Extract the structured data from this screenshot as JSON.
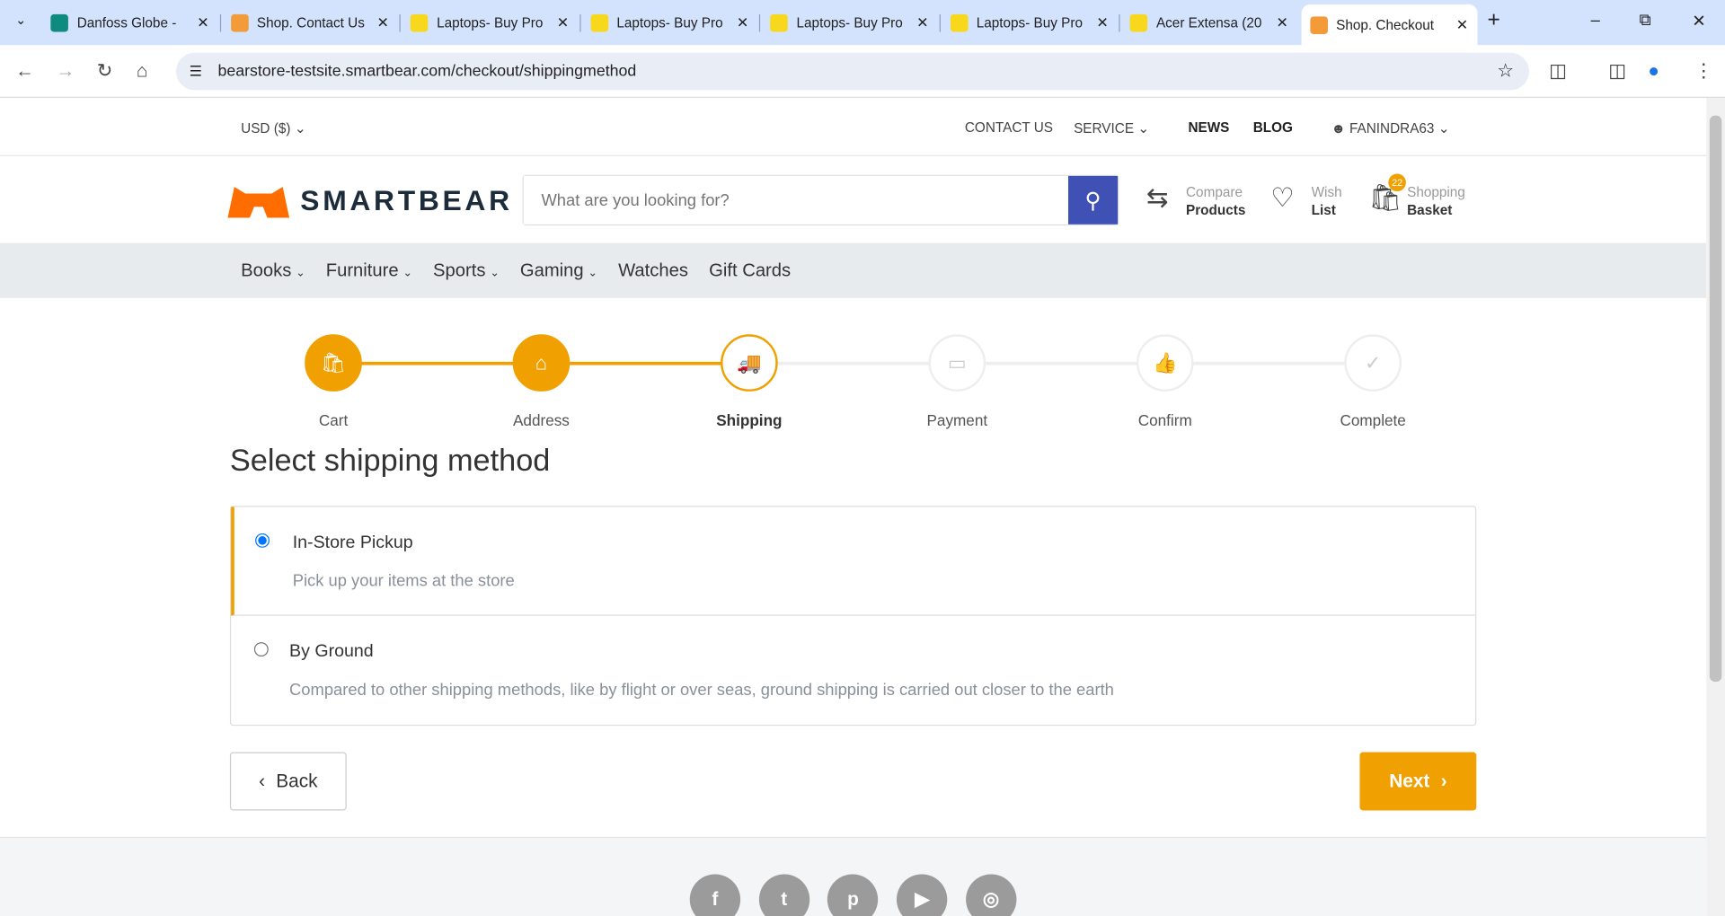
{
  "browser": {
    "tabs": [
      {
        "title": "Danfoss Globe -",
        "color": "#0e8a7e"
      },
      {
        "title": "Shop. Contact Us",
        "color": "#f29b38"
      },
      {
        "title": "Laptops- Buy Pro",
        "color": "#f8d81c"
      },
      {
        "title": "Laptops- Buy Pro",
        "color": "#f8d81c"
      },
      {
        "title": "Laptops- Buy Pro",
        "color": "#f8d81c"
      },
      {
        "title": "Laptops- Buy Pro",
        "color": "#f8d81c"
      },
      {
        "title": "Acer Extensa (20",
        "color": "#f8d81c"
      },
      {
        "title": "Shop. Checkout",
        "color": "#f29b38"
      }
    ],
    "url": "bearstore-testsite.smartbear.com/checkout/shippingmethod"
  },
  "topbar": {
    "currency": "USD  ($)",
    "contact": "CONTACT US",
    "service": "SERVICE",
    "news": "NEWS",
    "blog": "BLOG",
    "user": "FANINDRA63"
  },
  "header": {
    "logo": "SMARTBEAR",
    "search_placeholder": "What are you looking for?",
    "compare": [
      "Compare",
      "Products"
    ],
    "wish": [
      "Wish",
      "List"
    ],
    "basket": [
      "Shopping",
      "Basket"
    ],
    "basket_count": "22"
  },
  "menu": [
    {
      "label": "Books",
      "dropdown": true
    },
    {
      "label": "Furniture",
      "dropdown": true
    },
    {
      "label": "Sports",
      "dropdown": true
    },
    {
      "label": "Gaming",
      "dropdown": true
    },
    {
      "label": "Watches",
      "dropdown": false
    },
    {
      "label": "Gift Cards",
      "dropdown": false
    }
  ],
  "steps": [
    {
      "label": "Cart",
      "icon": "bag-icon",
      "state": "done"
    },
    {
      "label": "Address",
      "icon": "home-icon",
      "state": "done"
    },
    {
      "label": "Shipping",
      "icon": "truck-icon",
      "state": "current"
    },
    {
      "label": "Payment",
      "icon": "card-icon",
      "state": "todo"
    },
    {
      "label": "Confirm",
      "icon": "thumbs-up-icon",
      "state": "todo"
    },
    {
      "label": "Complete",
      "icon": "check-icon",
      "state": "todo"
    }
  ],
  "title": "Select shipping method",
  "options": [
    {
      "name": "In-Store Pickup",
      "desc": "Pick up your items at the store",
      "selected": true
    },
    {
      "name": "By Ground",
      "desc": "Compared to other shipping methods, like by flight or over seas, ground shipping is carried out closer to the earth",
      "selected": false
    }
  ],
  "buttons": {
    "back": "Back",
    "next": "Next"
  },
  "social": [
    "facebook",
    "twitter",
    "pinterest",
    "youtube",
    "instagram"
  ],
  "accent": "#f0a000"
}
